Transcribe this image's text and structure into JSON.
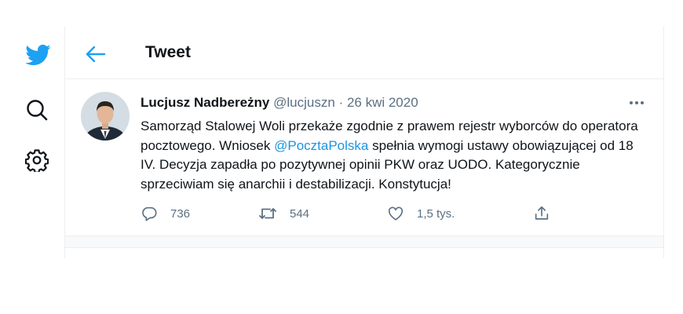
{
  "nav": {
    "icons": [
      "twitter-logo-icon",
      "search-icon",
      "gear-icon"
    ]
  },
  "header": {
    "title": "Tweet"
  },
  "tweet": {
    "author_name": "Lucjusz Nadbereżny",
    "handle": "@lucjuszn",
    "separator": "·",
    "date": "26 kwi 2020",
    "text_part1": "Samorząd Stalowej Woli przekaże zgodnie z prawem rejestr wyborców do operatora pocztowego. Wniosek ",
    "mention": "@PocztaPolska",
    "text_part2": " spełnia wymogi ustawy obowiązującej od 18 IV. Decyzja zapadła po pozytywnej opinii PKW oraz UODO. Kategorycznie sprzeciwiam się anarchii i destabilizacji. Konstytucja!",
    "reply_count": "736",
    "retweet_count": "544",
    "like_count": "1,5 tys."
  },
  "colors": {
    "accent": "#1da1f2",
    "mention": "#1b95e0",
    "muted": "#5b7083",
    "border": "#ebeef0"
  }
}
